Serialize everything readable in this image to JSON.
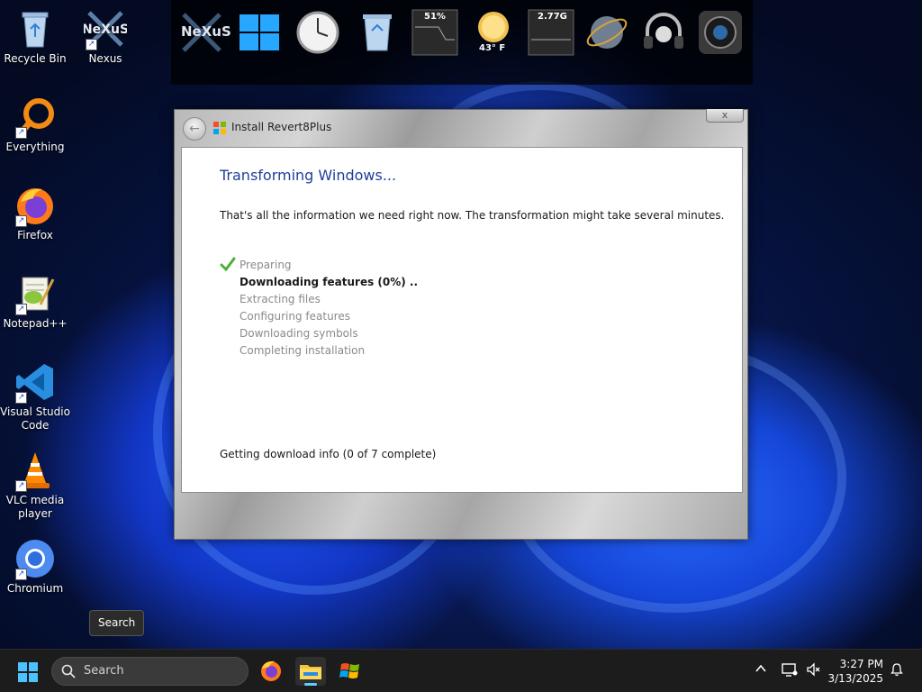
{
  "desktop": {
    "icons": [
      {
        "label": "Recycle Bin"
      },
      {
        "label": "Nexus"
      },
      {
        "label": "Everything"
      },
      {
        "label": "Firefox"
      },
      {
        "label": "Notepad++"
      },
      {
        "label": "Visual Studio Code"
      },
      {
        "label": "VLC media player"
      },
      {
        "label": "Chromium"
      }
    ]
  },
  "dock": {
    "logo_text": "NeXuS",
    "cpu_readout": "51%",
    "weather_temp": "43° F",
    "memory_readout": "2.77G"
  },
  "dialog": {
    "title": "Install Revert8Plus",
    "close_symbol": "x",
    "back_symbol": "←",
    "heading": "Transforming Windows...",
    "intro": "That's all the information we need right now. The transformation might take several minutes.",
    "steps": [
      {
        "label": "Preparing",
        "state": "done"
      },
      {
        "label": "Downloading features (0%) ..",
        "state": "active"
      },
      {
        "label": "Extracting files",
        "state": "pending"
      },
      {
        "label": "Configuring features",
        "state": "pending"
      },
      {
        "label": "Downloading symbols",
        "state": "pending"
      },
      {
        "label": "Completing installation",
        "state": "pending"
      }
    ],
    "status": "Getting download info (0 of 7 complete)"
  },
  "tooltip": {
    "text": "Search"
  },
  "taskbar": {
    "search_placeholder": "Search",
    "apps": [
      {
        "icon": "firefox-icon",
        "active": false
      },
      {
        "icon": "file-explorer-icon",
        "active": true
      },
      {
        "icon": "windows-xp-flag-icon",
        "active": false
      }
    ],
    "clock_time": "3:27 PM",
    "clock_date": "3/13/2025"
  },
  "colors": {
    "accent": "#60cdff",
    "heading_blue": "#1f3f9a",
    "check_green": "#4caf3a"
  }
}
